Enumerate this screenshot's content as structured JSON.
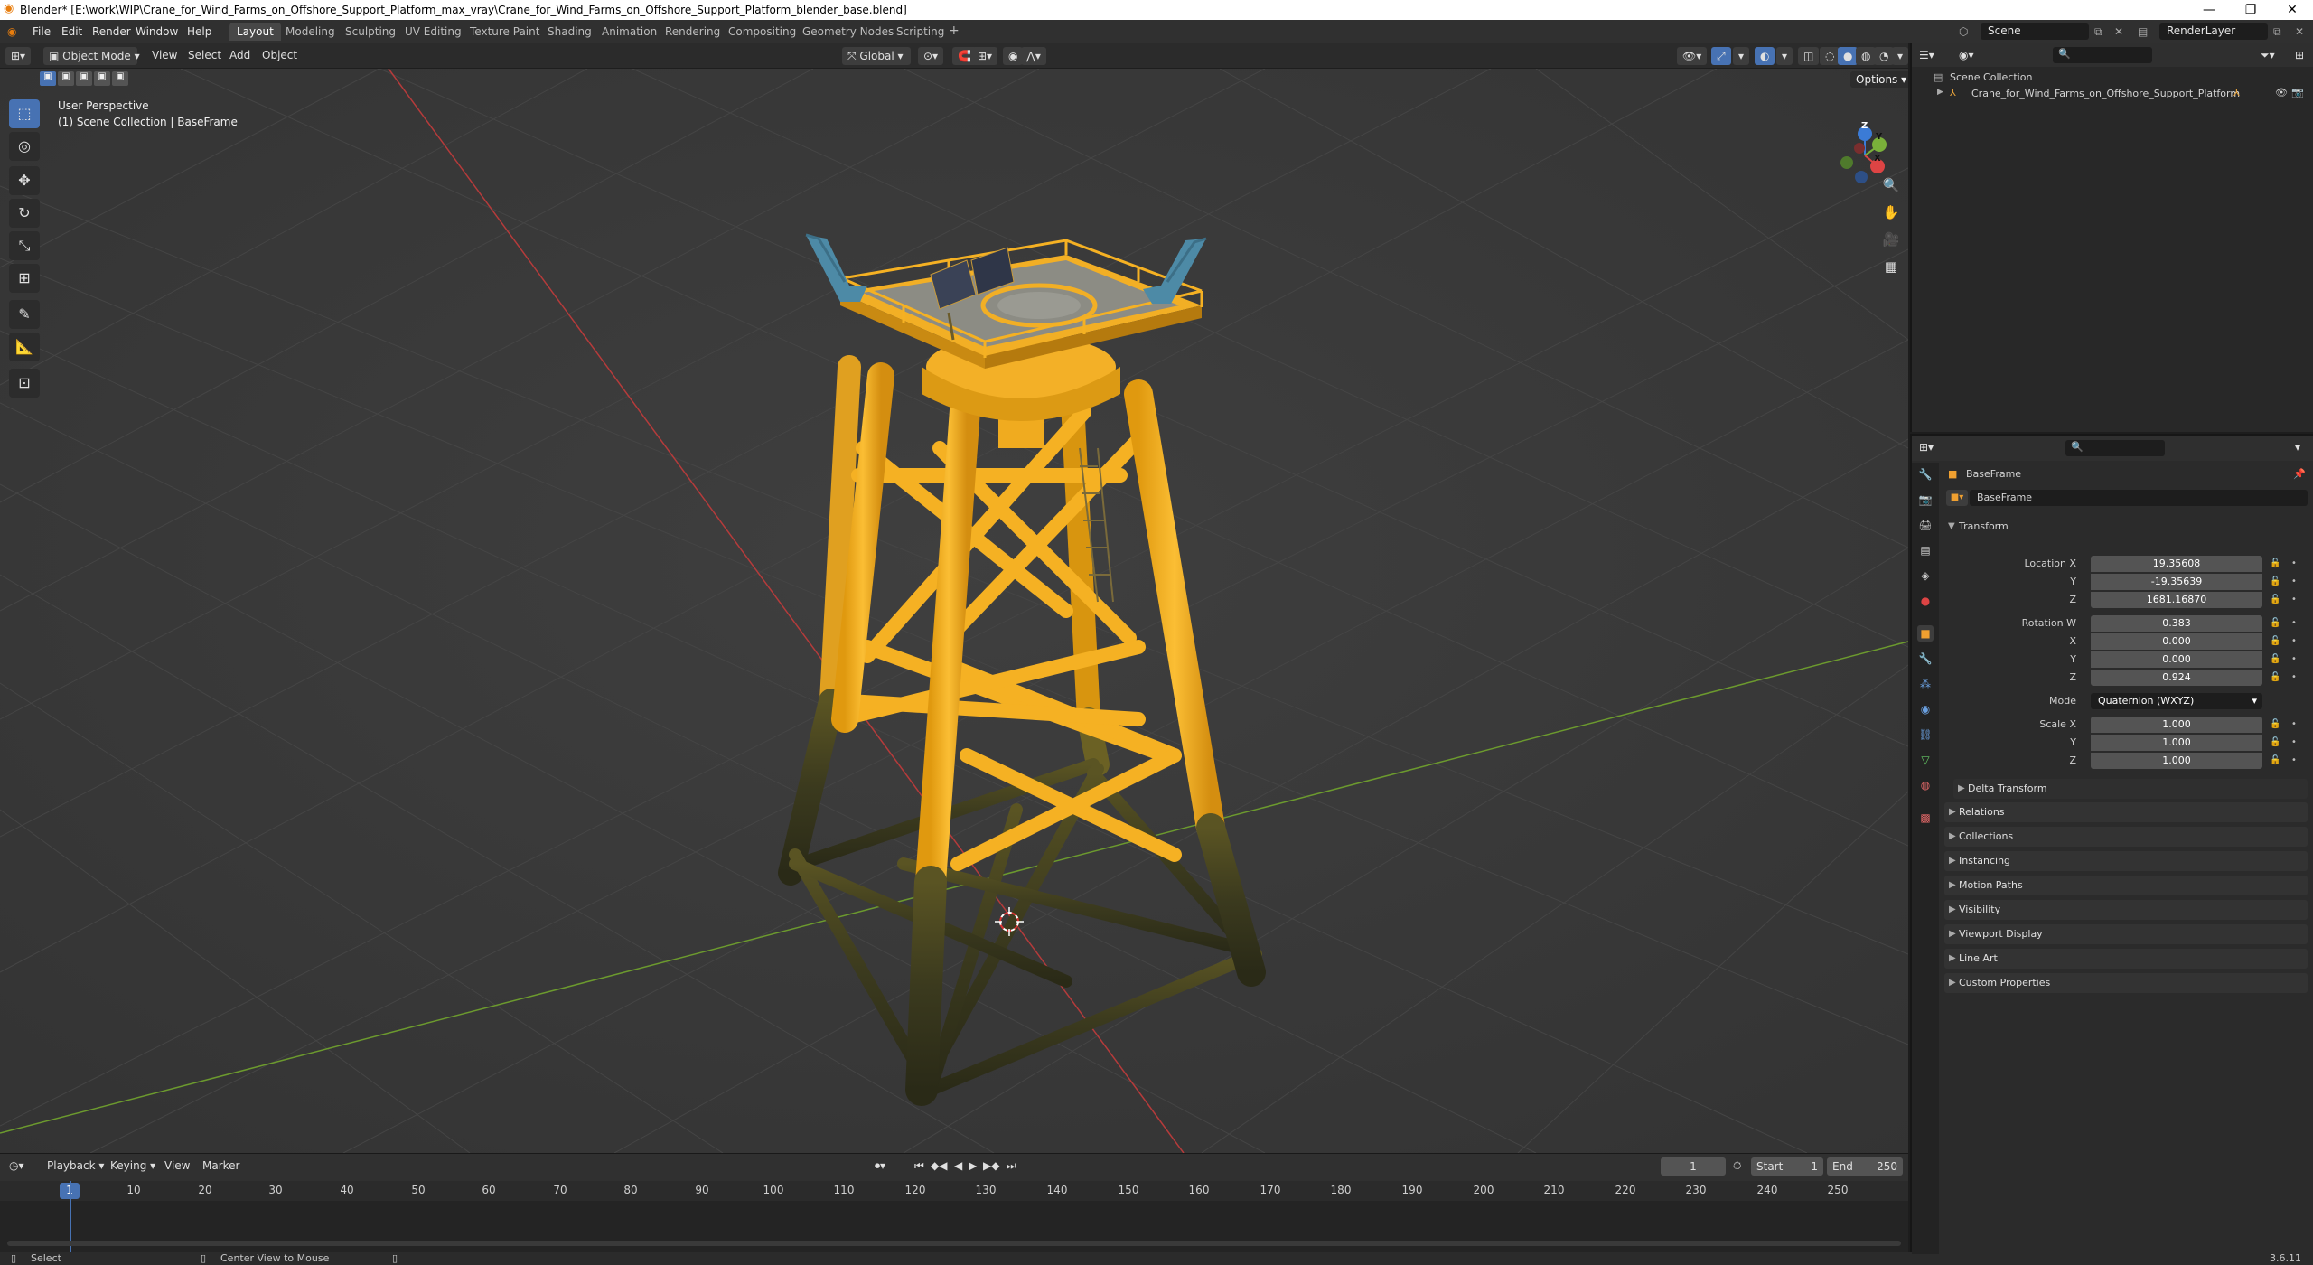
{
  "window": {
    "title": "Blender* [E:\\work\\WIP\\Crane_for_Wind_Farms_on_Offshore_Support_Platform_max_vray\\Crane_for_Wind_Farms_on_Offshore_Support_Platform_blender_base.blend]",
    "minimize": "—",
    "maximize": "❐",
    "close": "✕"
  },
  "menu": [
    "File",
    "Edit",
    "Render",
    "Window",
    "Help"
  ],
  "workspaces": [
    "Layout",
    "Modeling",
    "Sculpting",
    "UV Editing",
    "Texture Paint",
    "Shading",
    "Animation",
    "Rendering",
    "Compositing",
    "Geometry Nodes",
    "Scripting"
  ],
  "active_workspace": "Layout",
  "add_workspace": "+",
  "scene": {
    "name": "Scene",
    "render_layer": "RenderLayer"
  },
  "viewport_header": {
    "mode": "Object Mode",
    "menus": [
      "View",
      "Select",
      "Add",
      "Object"
    ],
    "transform_orientation": "Global",
    "options": "Options"
  },
  "viewport": {
    "perspective": "User Perspective",
    "context": "(1) Scene Collection | BaseFrame",
    "gizmo": {
      "x": "X",
      "y": "Y",
      "z": "Z"
    }
  },
  "timeline": {
    "menus": [
      "Playback",
      "Keying",
      "View",
      "Marker"
    ],
    "current_frame": "1",
    "start_label": "Start",
    "start": "1",
    "end_label": "End",
    "end": "250",
    "ticks": [
      "1",
      "10",
      "20",
      "30",
      "40",
      "50",
      "60",
      "70",
      "80",
      "90",
      "100",
      "110",
      "120",
      "130",
      "140",
      "150",
      "160",
      "170",
      "180",
      "190",
      "200",
      "210",
      "220",
      "230",
      "240",
      "250"
    ]
  },
  "statusbar": {
    "select": "Select",
    "center_view": "Center View to Mouse",
    "version": "3.6.11"
  },
  "outliner": {
    "root": "Scene Collection",
    "items": [
      "Crane_for_Wind_Farms_on_Offshore_Support_Platform"
    ]
  },
  "properties": {
    "object_name": "BaseFrame",
    "data_name": "BaseFrame",
    "transform_title": "Transform",
    "location": {
      "label": "Location X",
      "x": "19.35608",
      "y_label": "Y",
      "y": "-19.35639",
      "z_label": "Z",
      "z": "1681.16870"
    },
    "rotation": {
      "label": "Rotation W",
      "w": "0.383",
      "x_label": "X",
      "x": "0.000",
      "y_label": "Y",
      "y": "0.000",
      "z_label": "Z",
      "z": "0.924"
    },
    "mode_label": "Mode",
    "mode": "Quaternion (WXYZ)",
    "scale": {
      "label": "Scale X",
      "x": "1.000",
      "y_label": "Y",
      "y": "1.000",
      "z_label": "Z",
      "z": "1.000"
    },
    "delta_transform": "Delta Transform",
    "sections": [
      "Relations",
      "Collections",
      "Instancing",
      "Motion Paths",
      "Visibility",
      "Viewport Display",
      "Line Art",
      "Custom Properties"
    ]
  },
  "colors": {
    "accent_blue": "#4772b3",
    "structure_yellow": "#f5b123",
    "grid_x_axis": "#b53b3b",
    "grid_y_axis": "#6c9a2e",
    "background": "#3a3a3a"
  }
}
